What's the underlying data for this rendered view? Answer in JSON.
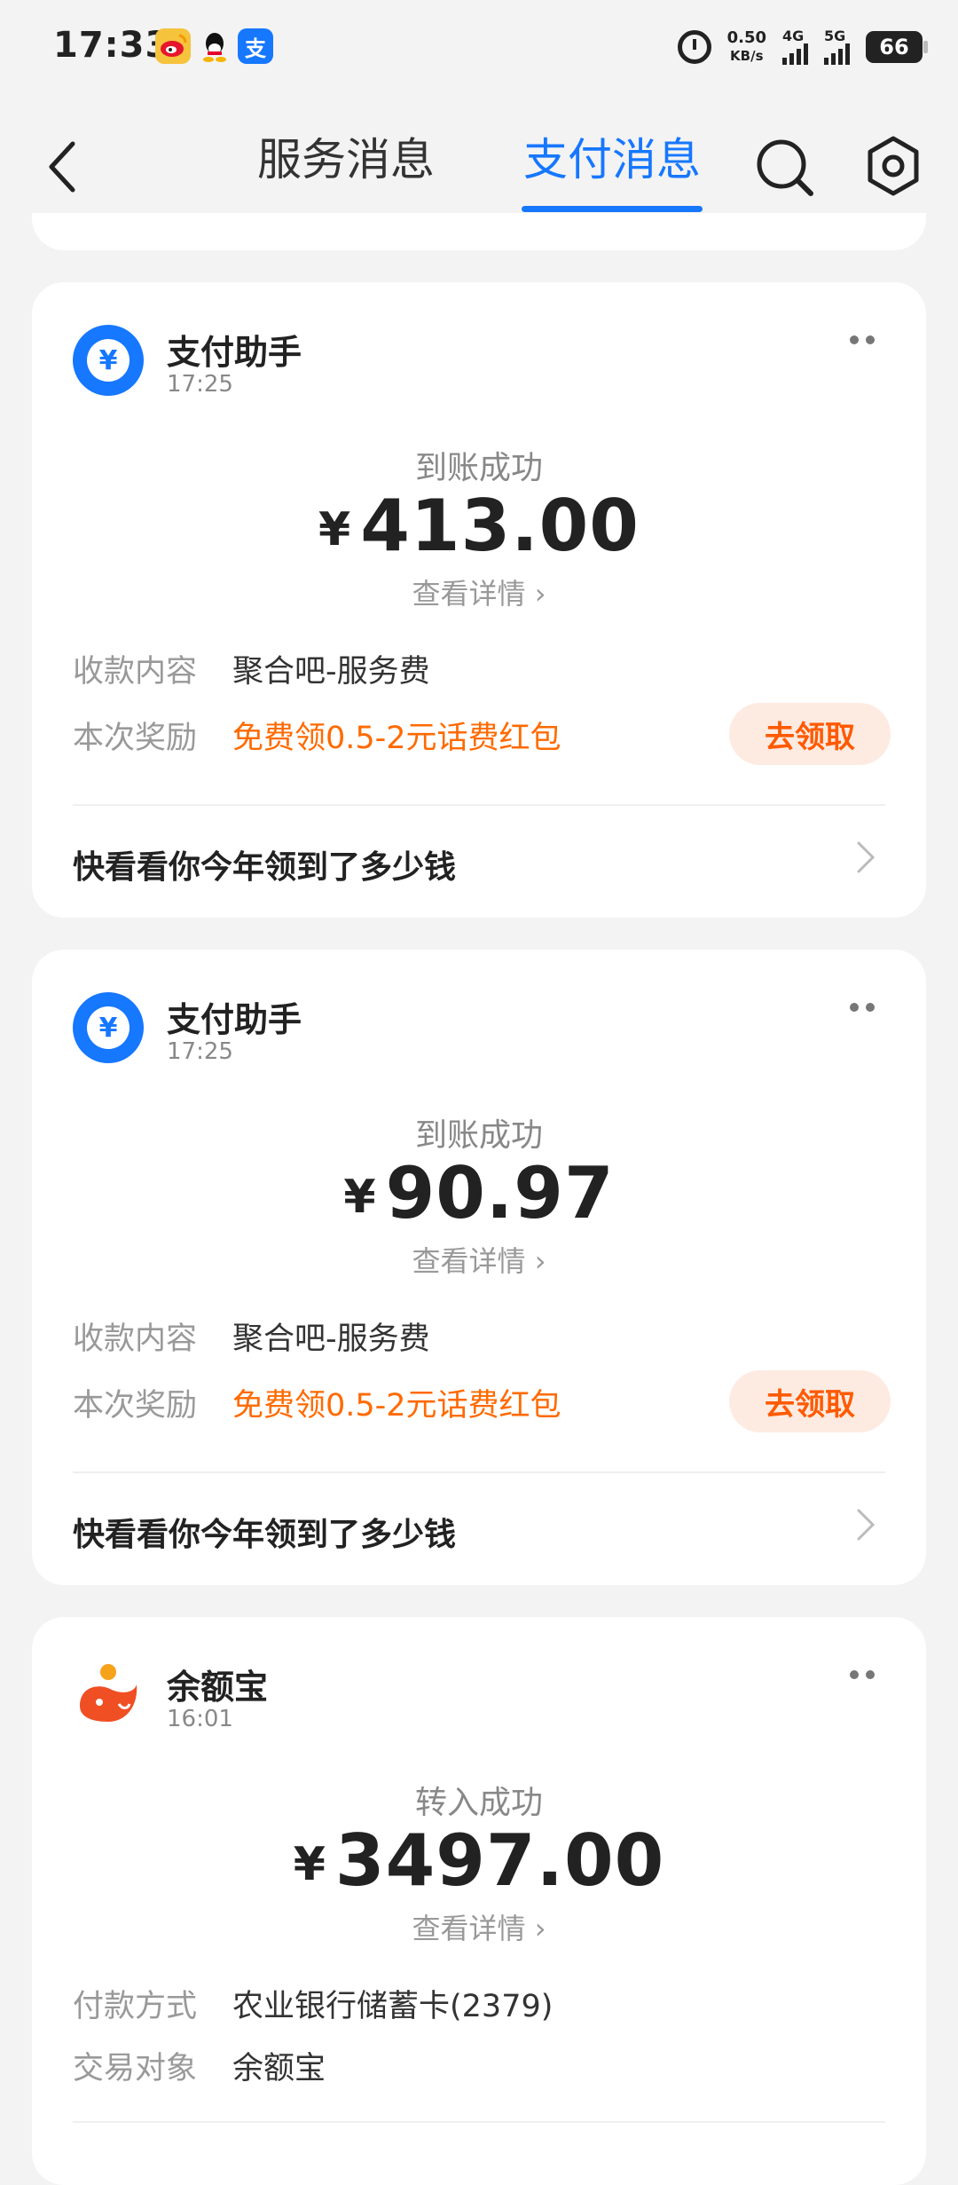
{
  "statusbar": {
    "time": "17:33",
    "apps": [
      "weibo-icon",
      "qq-icon",
      "alipay-icon"
    ],
    "alipay_glyph": "支",
    "net_speed_value": "0.50",
    "net_speed_unit": "KB/s",
    "sig1": "4G",
    "sig2": "5G",
    "battery": "66"
  },
  "header": {
    "tab_service": "服务消息",
    "tab_pay": "支付消息",
    "active_tab": "支付消息",
    "accent": "#1677ff"
  },
  "cards": [
    {
      "sender": "支付助手",
      "time": "17:25",
      "avatar_glyph": "¥",
      "status": "到账成功",
      "currency": "¥",
      "amount": "413.00",
      "detail": "查看详情",
      "rows": [
        {
          "label": "收款内容",
          "value": "聚合吧-服务费"
        },
        {
          "label": "本次奖励",
          "value": "免费领0.5-2元话费红包"
        }
      ],
      "claim_button": "去领取",
      "footer": "快看看你今年领到了多少钱"
    },
    {
      "sender": "支付助手",
      "time": "17:25",
      "avatar_glyph": "¥",
      "status": "到账成功",
      "currency": "¥",
      "amount": "90.97",
      "detail": "查看详情",
      "rows": [
        {
          "label": "收款内容",
          "value": "聚合吧-服务费"
        },
        {
          "label": "本次奖励",
          "value": "免费领0.5-2元话费红包"
        }
      ],
      "claim_button": "去领取",
      "footer": "快看看你今年领到了多少钱"
    },
    {
      "sender": "余额宝",
      "time": "16:01",
      "status": "转入成功",
      "currency": "¥",
      "amount": "3497.00",
      "detail": "查看详情",
      "rows": [
        {
          "label": "付款方式",
          "value": "农业银行储蓄卡(2379)"
        },
        {
          "label": "交易对象",
          "value": "余额宝"
        }
      ]
    }
  ],
  "colors": {
    "reward_orange": "#ff6a00",
    "claim_bg": "#fdebe2"
  }
}
